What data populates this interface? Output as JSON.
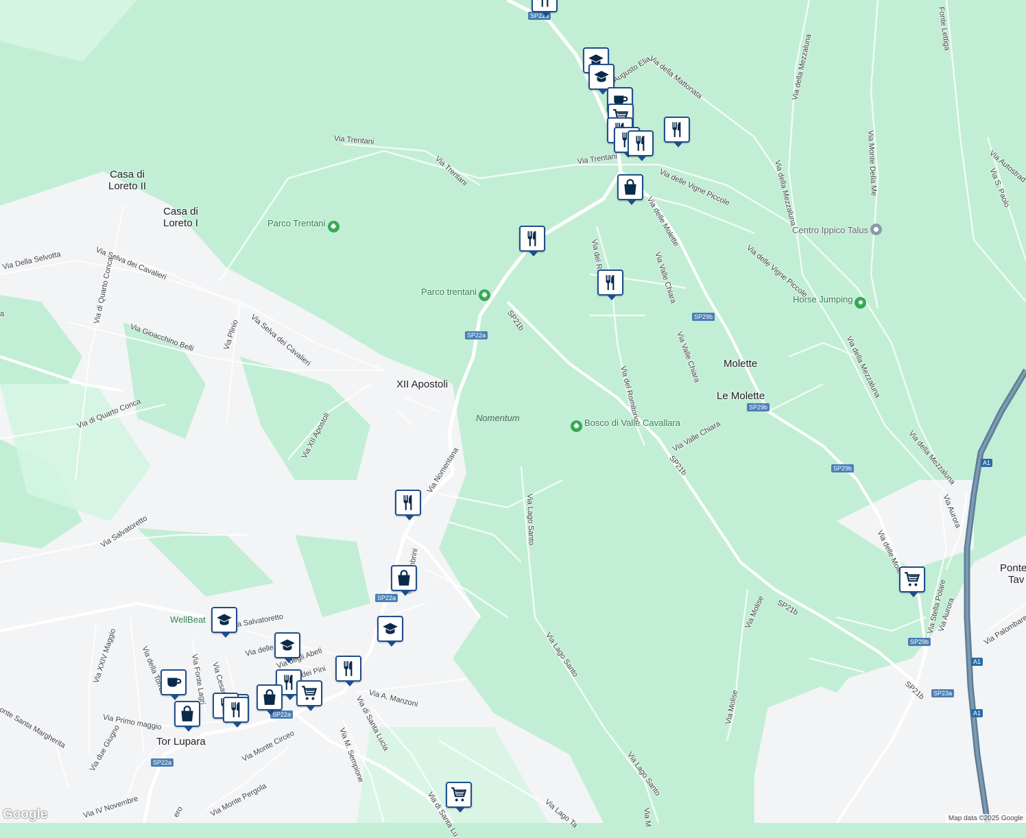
{
  "colors": {
    "park": "#c3eed6",
    "urban": "#f3f4f6",
    "road": "#ffffff",
    "highway": "#5f7d95",
    "marker_border": "#1f4e8c",
    "shield": "#4a7fb5"
  },
  "places": {
    "casa_loreto_ii_a": "Casa di",
    "casa_loreto_ii_b": "Loreto II",
    "casa_loreto_i_a": "Casa di",
    "casa_loreto_i_b": "Loreto I",
    "xii_apostoli": "XII Apostoli",
    "molette": "Molette",
    "le_molette": "Le Molette",
    "tor_lupara": "Tor Lupara",
    "ponte_a": "Ponte",
    "ponte_b": "Tav"
  },
  "parks": {
    "parco_trentani_1": "Parco Trentani",
    "parco_trentani_2": "Parco trentani",
    "bosco": "Bosco di Valle Cavallara",
    "nomentum": "Nomentum",
    "wellbeat": "WellBeat"
  },
  "pois": {
    "centro_ippico": "Centro Ippico Talus",
    "horse_jumping": "Horse Jumping"
  },
  "streets": {
    "via_trentani_1": "Via Trentani",
    "via_trentani_2": "Via Trentani",
    "via_trentani_3": "Via Trentani",
    "augusto_elia": "Augusto Elia",
    "via_della_mattonata": "Via della Mattonata",
    "via_della_mezzaluna_1": "Via della Mezzaluna",
    "via_della_mezzaluna_2": "Via della Mezzaluna",
    "via_della_mezzaluna_3": "Via della Mezzaluna",
    "via_della_mezzaluna_4": "Via della Mezzaluna",
    "via_monte_della_me": "Via Monte Della Me",
    "fonte_lettiga": "Fonte Lettiga",
    "via_autostrad": "Via Autostrad",
    "via_s_paolo": "Via S. Paolo",
    "via_delle_vigne_piccole_1": "Via delle Vigne Piccole",
    "via_delle_vigne_piccole_2": "Via delle Vigne Piccole",
    "via_delle_molette": "Via delle Molette",
    "via_delle_mole": "Via delle Mole",
    "via_del_romitorio_1": "Via del Romitorio",
    "via_del_romitorio_2": "Via del Romitorio",
    "via_valle_chiara_1": "Via Valle Chiara",
    "via_valle_chiara_2": "Via Valle Chiara",
    "via_valle_chiara_3": "Via Valle Chiara",
    "sp21b_1": "SP21b",
    "sp21b_2": "SP21b",
    "sp21b_3": "SP21b",
    "sp21b_4": "SP21b",
    "via_della_selvotta": "Via Della Selvotta",
    "via_selva_dei_cavalieri_1": "Via Selva dei Cavalieri",
    "via_selva_dei_cavalieri_2": "Via Selva dei Cavalieri",
    "via_di_quarto_conca_1": "Via di Quarto Conca",
    "via_di_quarto_conca_2": "Via di Quarto Conca",
    "via_gioacchino_belli": "Via Gioacchino Belli",
    "via_plinio": "Via Plinio",
    "via_xii_apostoli": "Via XII Apostoli",
    "via_salvatoretto_1": "Via Salvatoretto",
    "via_salvatoretto_2": "a Salvatoretto",
    "via_nomentana_1": "Via Nomentana",
    "via_lago_santo_1": "Via Lago Santo",
    "via_lago_santo_2": "Via Lago Santo",
    "via_lago_santo_3": "Via Lago Santo",
    "via_lago_ta": "Via Lago Ta",
    "via_molise_1": "Via Molise",
    "via_molise_2": "Via Molise",
    "via_aurora_1": "Via Aurora",
    "via_aurora_2": "Via Aurora",
    "via_stella_polare": "Via Stella Polare",
    "via_palombarese": "Via Palombarese",
    "via_xxiv_maggio": "Via XXIV Maggio",
    "via_della_torre": "Via della Torre",
    "via_fonte_lagrima": "Via Fonte Lagri",
    "via_cesare": "Via Cesare",
    "via_delle_m": "Via delle M",
    "via_degli_abeti": "Via degli Abeti",
    "via_dei_pini": "Via dei Pini",
    "settembrini": "gi Settembrini",
    "via_a_manzoni": "Via A. Manzoni",
    "via_di_santa_lucia_1": "Via di Santa Lucia",
    "via_di_santa_lucia_2": "Via di Santa Lu",
    "via_m_sempione": "Via M. Sempione",
    "via_primo_maggio": "Via Primo maggio",
    "via_due_giugno": "Via due Giugno",
    "via_monte_circeo": "Via Monte Circeo",
    "via_iv_novembre": "Via IV Novembre",
    "monte_santa_margherita": "onte Santa Margherita",
    "via_monte_pergola": "Via Monte Pergola",
    "via_m": "Via M",
    "via_edge": "a",
    "via_pi": "ero"
  },
  "shields": {
    "sp22a_1": "SP22a",
    "sp22a_2": "SP22a",
    "sp22a_3": "SP22a",
    "sp22a_4": "SP22a",
    "sp22a_5": "SP22a",
    "sp29b_1": "SP29b",
    "sp29b_2": "SP29b",
    "sp29b_3": "SP29b",
    "sp29b_4": "SP29b",
    "sp23a": "SP23a",
    "a1_1": "A1",
    "a1_2": "A1",
    "a1_3": "A1"
  },
  "markers": [
    {
      "type": "restaurant",
      "icon": "restaurant-icon"
    },
    {
      "type": "school",
      "icon": "school-icon"
    },
    {
      "type": "school",
      "icon": "school-icon"
    },
    {
      "type": "cafe",
      "icon": "coffee-icon"
    },
    {
      "type": "shopping-cart",
      "icon": "cart-icon"
    },
    {
      "type": "restaurant",
      "icon": "restaurant-icon"
    },
    {
      "type": "restaurant",
      "icon": "restaurant-icon"
    },
    {
      "type": "restaurant",
      "icon": "restaurant-icon"
    },
    {
      "type": "restaurant",
      "icon": "restaurant-icon"
    },
    {
      "type": "shopping-bag",
      "icon": "bag-icon"
    },
    {
      "type": "restaurant",
      "icon": "restaurant-icon"
    },
    {
      "type": "restaurant",
      "icon": "restaurant-icon"
    },
    {
      "type": "school",
      "icon": "school-icon"
    },
    {
      "type": "restaurant",
      "icon": "restaurant-icon"
    },
    {
      "type": "shopping-bag",
      "icon": "bag-icon"
    },
    {
      "type": "school",
      "icon": "school-icon"
    },
    {
      "type": "school",
      "icon": "school-icon"
    },
    {
      "type": "restaurant",
      "icon": "restaurant-icon"
    },
    {
      "type": "restaurant",
      "icon": "restaurant-icon"
    },
    {
      "type": "cafe",
      "icon": "coffee-icon"
    },
    {
      "type": "restaurant",
      "icon": "restaurant-icon"
    },
    {
      "type": "shopping-cart",
      "icon": "cart-icon"
    },
    {
      "type": "shopping-bag",
      "icon": "bag-icon"
    },
    {
      "type": "restaurant",
      "icon": "restaurant-icon"
    },
    {
      "type": "restaurant",
      "icon": "restaurant-icon"
    },
    {
      "type": "shopping-bag",
      "icon": "bag-icon"
    },
    {
      "type": "shopping-cart",
      "icon": "cart-icon"
    },
    {
      "type": "shopping-cart",
      "icon": "cart-icon"
    }
  ],
  "logo": "Google",
  "attribution": "Map data ©2025 Google"
}
